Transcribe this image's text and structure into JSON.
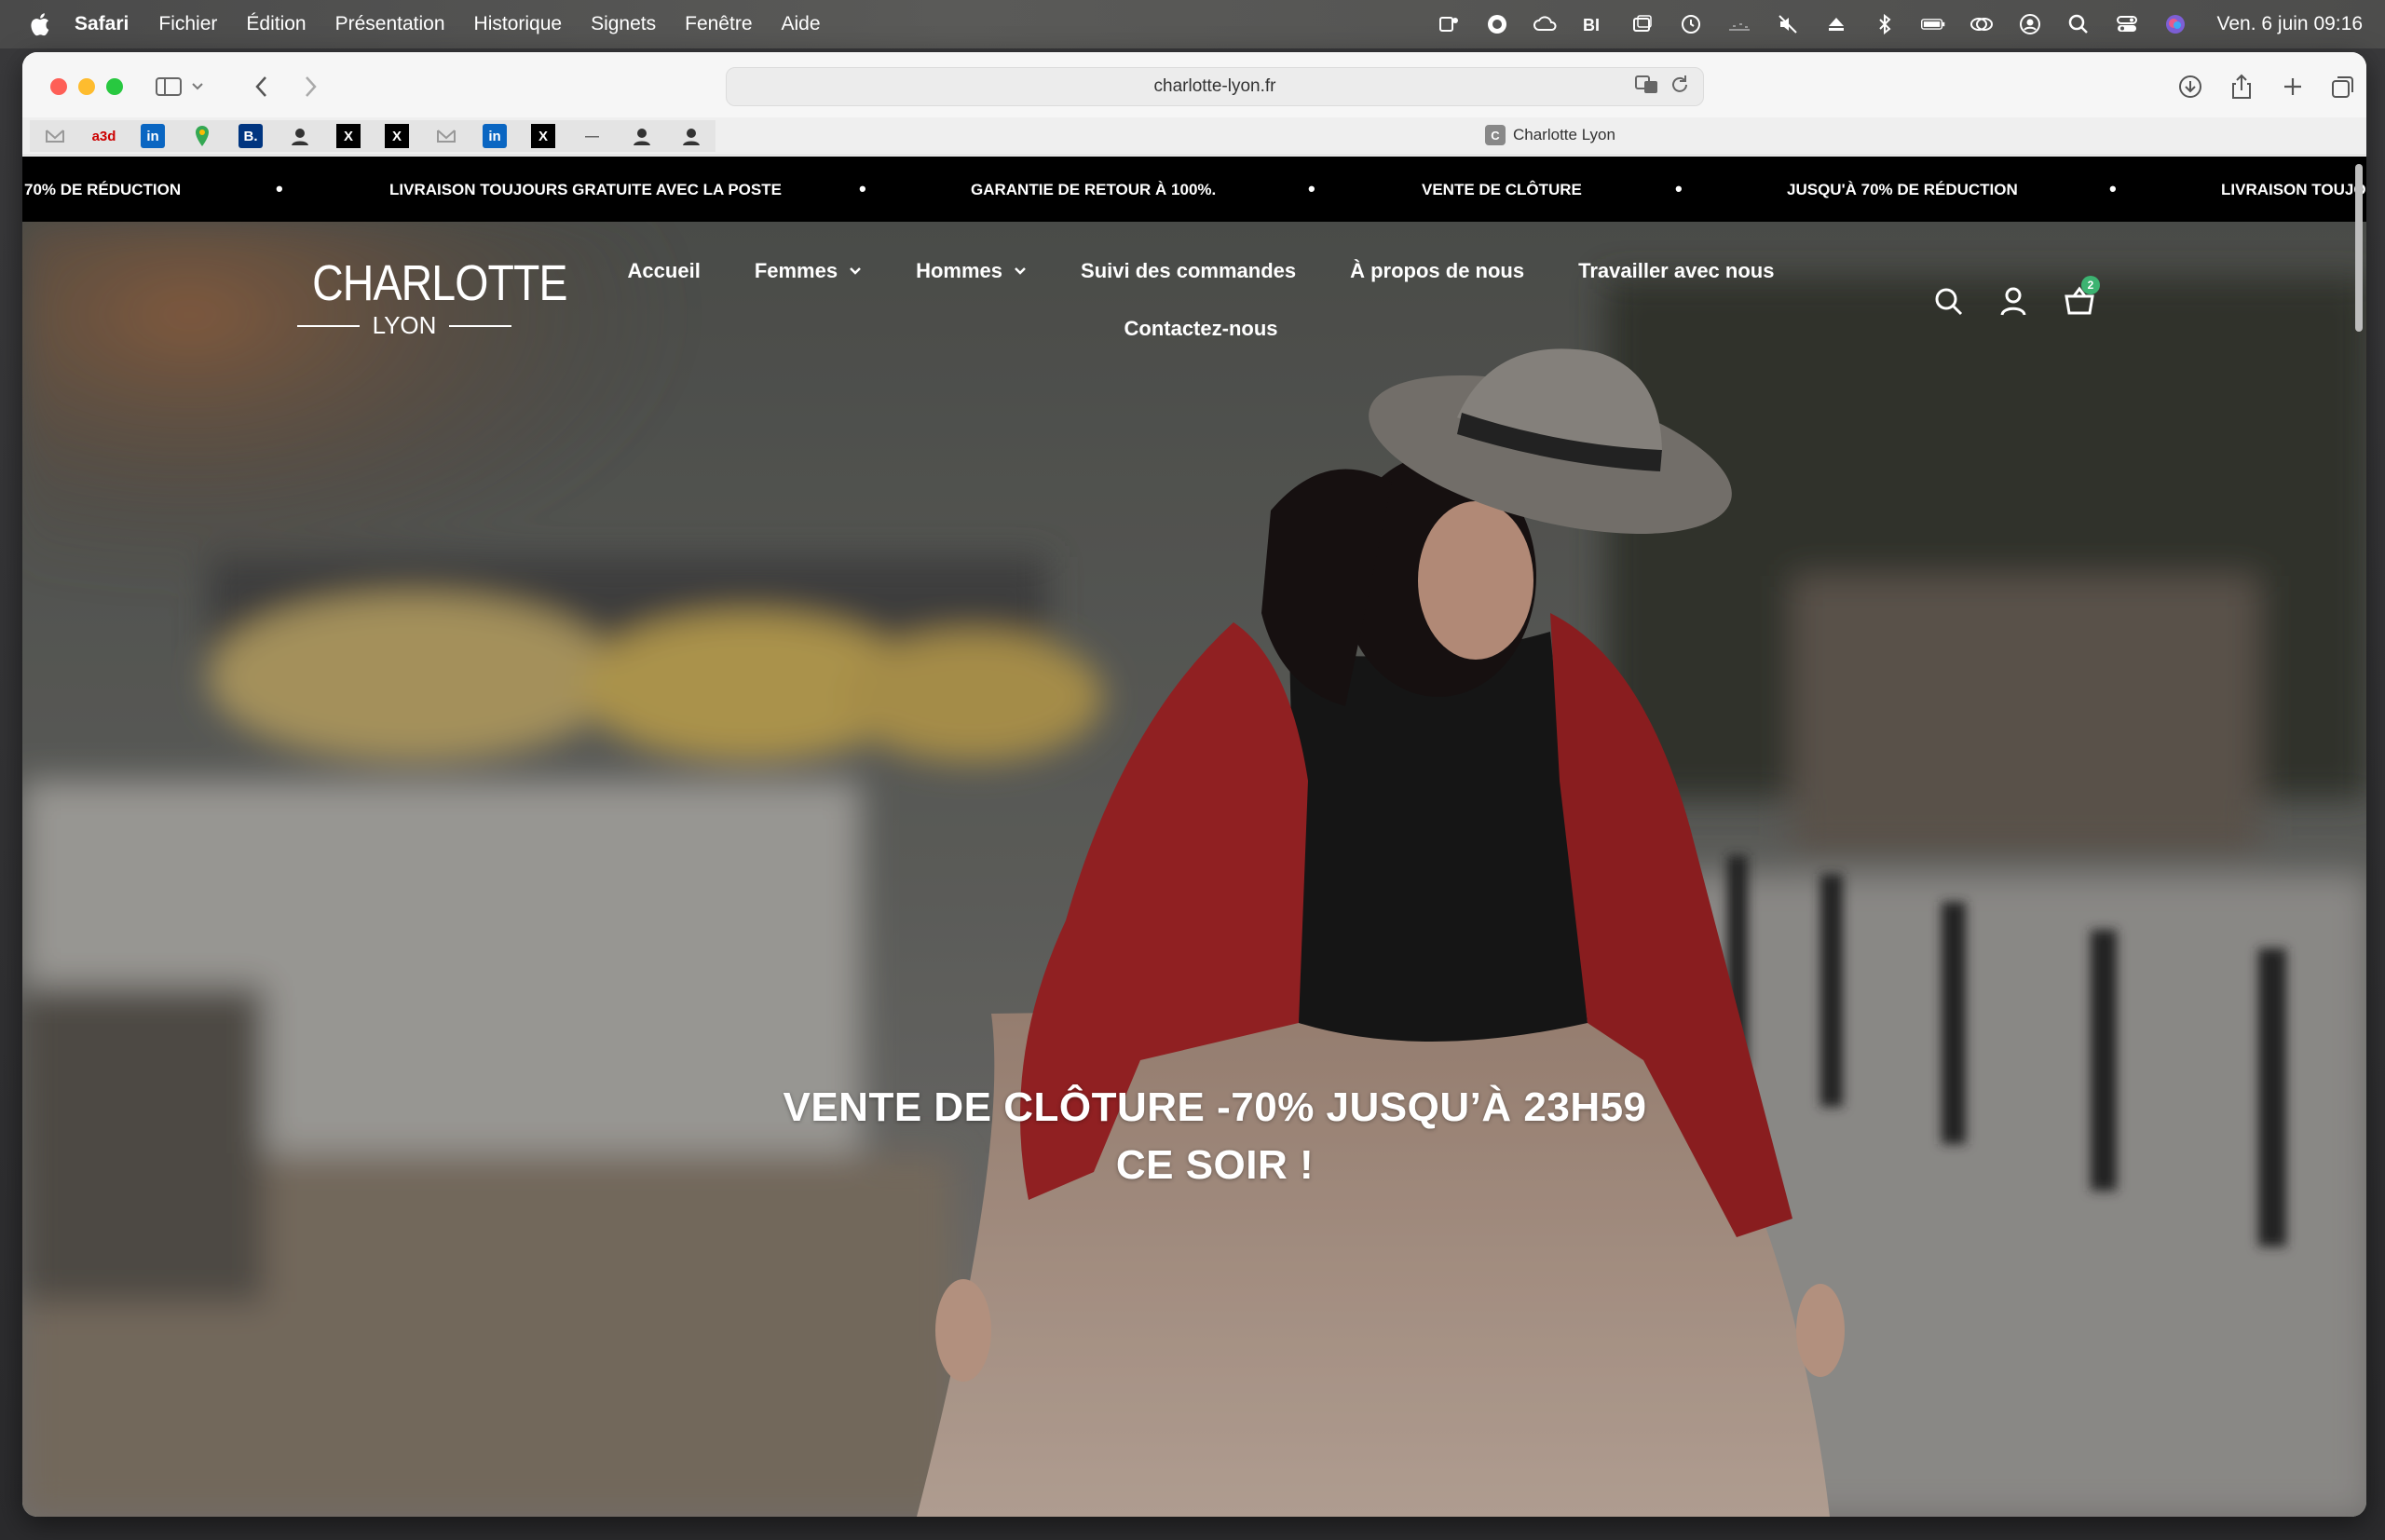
{
  "menubar": {
    "app_name": "Safari",
    "menus": [
      "Fichier",
      "Édition",
      "Présentation",
      "Historique",
      "Signets",
      "Fenêtre",
      "Aide"
    ],
    "clock": "Ven. 6 juin  09:16"
  },
  "browser": {
    "url": "charlotte-lyon.fr",
    "tab_title": "Charlotte Lyon",
    "tab_favicon_letter": "C",
    "favorites": [
      "",
      "a3d",
      "in",
      "",
      "B.",
      "",
      "X",
      "X",
      "",
      "in",
      "X",
      "—",
      "",
      ""
    ]
  },
  "announcement_bar": {
    "items": [
      "70% DE RÉDUCTION",
      "LIVRAISON TOUJOURS GRATUITE AVEC LA POSTE",
      "GARANTIE DE RETOUR À 100%.",
      "VENTE DE CLÔTURE",
      "JUSQU'À 70% DE RÉDUCTION",
      "LIVRAISON TOUJOURS"
    ],
    "separator": "•"
  },
  "header": {
    "logo_main": "CHARLOTTE",
    "logo_sub": "LYON",
    "nav_row1": [
      {
        "label": "Accueil",
        "dropdown": false
      },
      {
        "label": "Femmes",
        "dropdown": true
      },
      {
        "label": "Hommes",
        "dropdown": true
      },
      {
        "label": "Suivi des commandes",
        "dropdown": false
      },
      {
        "label": "À propos de nous",
        "dropdown": false
      },
      {
        "label": "Travailler avec nous",
        "dropdown": false
      }
    ],
    "nav_row2": [
      {
        "label": "Contactez-nous",
        "dropdown": false
      }
    ],
    "cart_count": "2"
  },
  "hero": {
    "title_line1": "VENTE DE CLÔTURE -70% JUSQU’À 23H59",
    "title_line2": "CE SOIR !"
  },
  "colors": {
    "marquee_bg": "#000000",
    "cart_badge": "#3cb371",
    "jacket_red": "#b0282a"
  }
}
